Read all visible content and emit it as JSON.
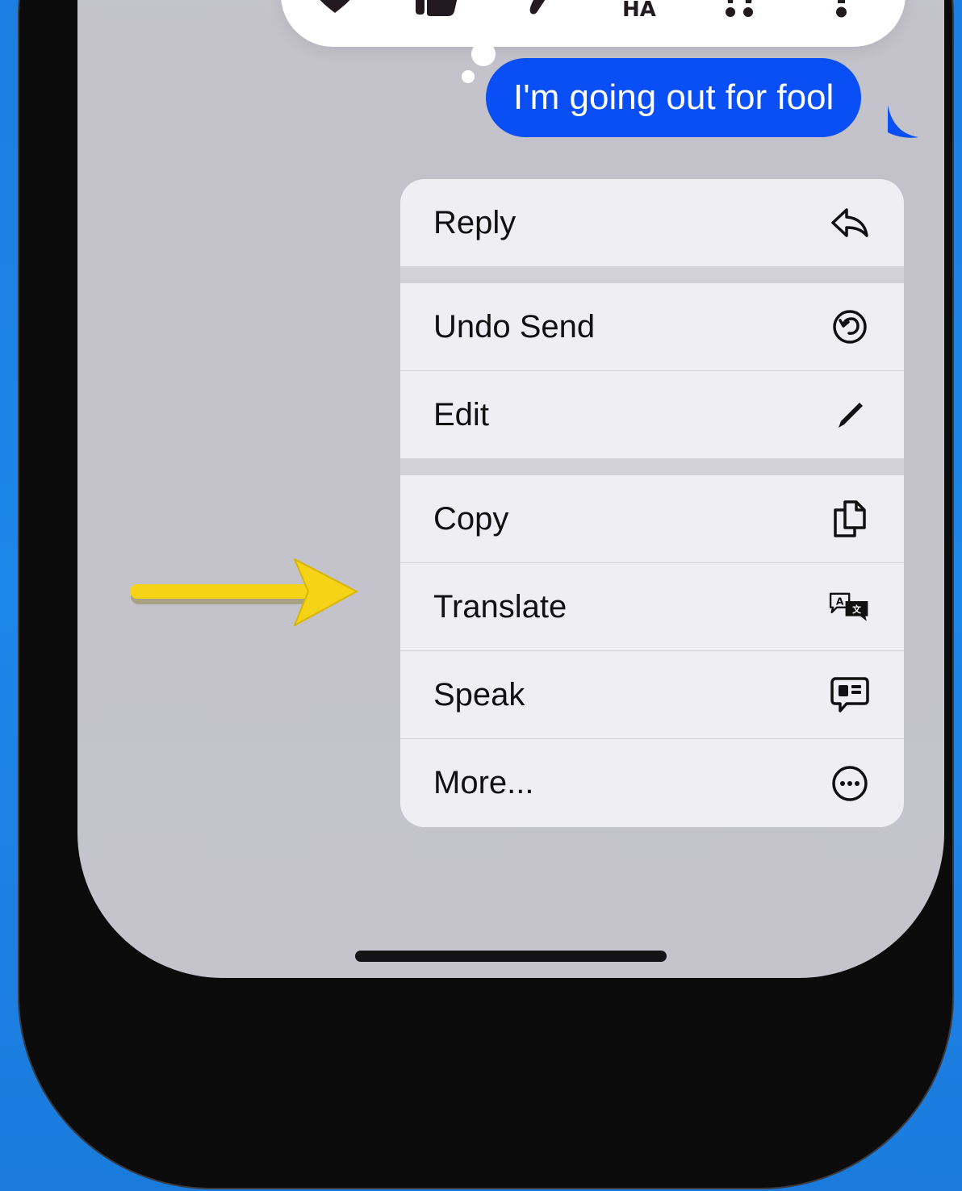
{
  "tapbacks": [
    {
      "name": "heart-icon",
      "label": "Heart"
    },
    {
      "name": "thumbs-up-icon",
      "label": "Like"
    },
    {
      "name": "thumbs-down-icon",
      "label": "Dislike"
    },
    {
      "name": "haha-icon",
      "label": "HA HA"
    },
    {
      "name": "exclamation-icon",
      "label": "Emphasize"
    },
    {
      "name": "question-icon",
      "label": "Question"
    }
  ],
  "message": {
    "text": "I'm going out for fool"
  },
  "menu": {
    "items": [
      {
        "label": "Reply",
        "icon": "reply-icon"
      },
      {
        "label": "Undo Send",
        "icon": "undo-send-icon"
      },
      {
        "label": "Edit",
        "icon": "pencil-icon"
      },
      {
        "label": "Copy",
        "icon": "copy-icon"
      },
      {
        "label": "Translate",
        "icon": "translate-icon"
      },
      {
        "label": "Speak",
        "icon": "speak-icon"
      },
      {
        "label": "More...",
        "icon": "more-icon"
      }
    ]
  },
  "annotation": {
    "arrow_color": "#f5d316",
    "points_to": "Edit"
  },
  "colors": {
    "background": "#1d86ea",
    "bubble": "#0a4ef6",
    "menu_bg": "#efeef2",
    "screen": "#c5c4cc"
  }
}
